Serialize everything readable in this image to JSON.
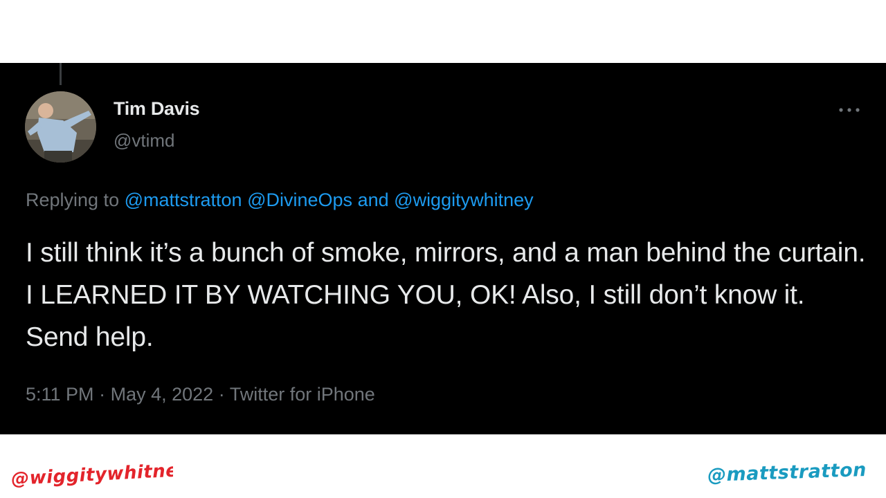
{
  "tweet": {
    "author_name": "Tim Davis",
    "author_handle": "@vtimd",
    "more_icon": "more-horizontal-icon",
    "avatar_icon": "user-avatar-photo",
    "replying_prefix": "Replying to",
    "replying_mentions": [
      "@mattstratton",
      "@DivineOps"
    ],
    "replying_and": "and",
    "replying_last_mention": "@wiggitywhitney",
    "text": "I still think it’s a bunch of smoke, mirrors, and a man behind the curtain. I LEARNED IT BY WATCHING YOU, OK! Also, I still don’t know it. Send help.",
    "time": "5:11 PM",
    "date": "May 4, 2022",
    "separator": "·",
    "source": "Twitter for iPhone"
  },
  "slide": {
    "handle_left": "@wiggitywhitney",
    "handle_right": "@mattstratton"
  },
  "colors": {
    "card_background": "#000000",
    "text_primary": "#e7e9ea",
    "text_secondary": "#71767b",
    "link_blue": "#1d9bf0",
    "handle_left_red": "#e3242b",
    "handle_right_teal": "#1a9bc0"
  }
}
